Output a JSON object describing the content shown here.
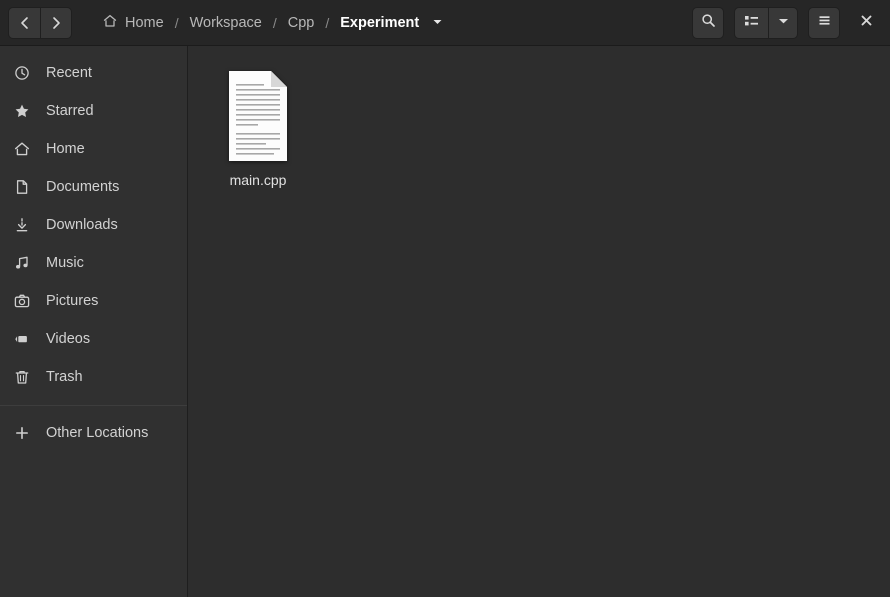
{
  "window": {
    "title": "Experiment",
    "colors": {
      "header_bg": "#262626",
      "sidebar_bg": "#303030",
      "content_bg": "#2d2d2d",
      "button_bg": "#383838",
      "text": "#d2d2d2",
      "text_active": "#ffffff",
      "separator": "#1e1e1e"
    }
  },
  "header": {
    "nav": {
      "back_label": "Back",
      "back_icon": "chevron-left-icon",
      "forward_label": "Forward",
      "forward_icon": "chevron-right-icon"
    },
    "breadcrumb": {
      "separator": "/",
      "items": [
        {
          "label": "Home",
          "icon": "home-icon",
          "current": false
        },
        {
          "label": "Workspace",
          "icon": "",
          "current": false
        },
        {
          "label": "Cpp",
          "icon": "",
          "current": false
        },
        {
          "label": "Experiment",
          "icon": "",
          "current": true
        }
      ],
      "dropdown_icon": "chevron-down-icon"
    },
    "actions": [
      {
        "name": "search-button",
        "icon": "search-icon",
        "label": "Search"
      },
      {
        "name": "view-mode-button",
        "icon": "list-view-icon",
        "label": "List view"
      },
      {
        "name": "view-mode-dropdown",
        "icon": "chevron-down-icon",
        "label": "View options"
      },
      {
        "name": "menu-button",
        "icon": "hamburger-menu-icon",
        "label": "Main menu"
      },
      {
        "name": "close-button",
        "icon": "close-icon",
        "label": "Close"
      }
    ]
  },
  "sidebar": {
    "items": [
      {
        "label": "Recent",
        "icon": "clock-icon"
      },
      {
        "label": "Starred",
        "icon": "star-icon"
      },
      {
        "label": "Home",
        "icon": "home-icon"
      },
      {
        "label": "Documents",
        "icon": "document-icon"
      },
      {
        "label": "Downloads",
        "icon": "download-icon"
      },
      {
        "label": "Music",
        "icon": "music-note-icon"
      },
      {
        "label": "Pictures",
        "icon": "camera-icon"
      },
      {
        "label": "Videos",
        "icon": "video-camera-icon"
      },
      {
        "label": "Trash",
        "icon": "trash-icon"
      }
    ],
    "other_locations": {
      "label": "Other Locations",
      "icon": "plus-icon"
    }
  },
  "content": {
    "files": [
      {
        "name": "main.cpp",
        "icon": "text-document-icon",
        "selected": false
      }
    ]
  }
}
